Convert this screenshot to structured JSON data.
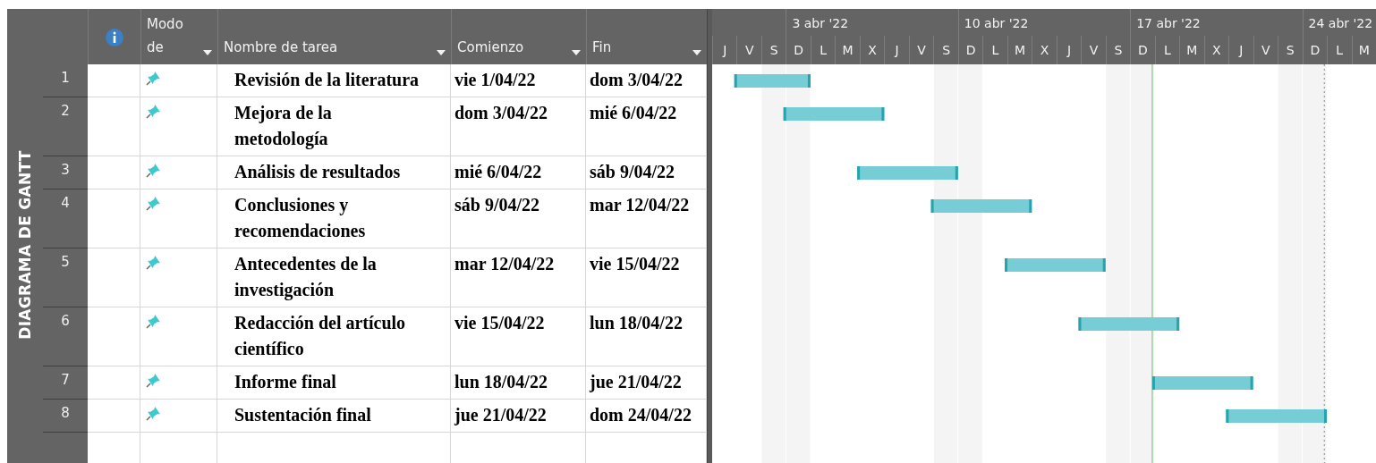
{
  "side_label": "DIAGRAMA DE GANTT",
  "columns": [
    {
      "kind": "info"
    },
    {
      "kind": "text",
      "label": "Modo\nde"
    },
    {
      "kind": "text",
      "label": "Nombre de tarea"
    },
    {
      "kind": "text",
      "label": "Comienzo"
    },
    {
      "kind": "text",
      "label": "Fin"
    }
  ],
  "tasks": [
    {
      "id": "1",
      "name": "Revisión de la literatura",
      "start": "vie 1/04/22",
      "end": "dom 3/04/22"
    },
    {
      "id": "2",
      "name": "Mejora de la\nmetodología",
      "start": "dom 3/04/22",
      "end": "mié 6/04/22"
    },
    {
      "id": "3",
      "name": "Análisis de resultados",
      "start": "mié 6/04/22",
      "end": "sáb 9/04/22"
    },
    {
      "id": "4",
      "name": "Conclusiones y\nrecomendaciones",
      "start": "sáb 9/04/22",
      "end": "mar 12/04/22"
    },
    {
      "id": "5",
      "name": "Antecedentes de la\ninvestigación",
      "start": "mar 12/04/22",
      "end": "vie 15/04/22"
    },
    {
      "id": "6",
      "name": "Redacción del artículo\ncientífico",
      "start": "vie 15/04/22",
      "end": "lun 18/04/22"
    },
    {
      "id": "7",
      "name": "Informe final",
      "start": "lun 18/04/22",
      "end": "jue 21/04/22"
    },
    {
      "id": "8",
      "name": "Sustentación final",
      "start": "jue 21/04/22",
      "end": "dom 24/04/22"
    }
  ],
  "timeline": {
    "weeks": [
      "3 abr '22",
      "10 abr '22",
      "17 abr '22",
      "24 abr '22"
    ],
    "days": [
      "J",
      "V",
      "S",
      "D",
      "L",
      "M",
      "X",
      "J",
      "V",
      "S",
      "D",
      "L",
      "M",
      "X",
      "J",
      "V",
      "S",
      "D",
      "L",
      "M",
      "X",
      "J",
      "V",
      "S",
      "D",
      "L",
      "M"
    ]
  }
}
